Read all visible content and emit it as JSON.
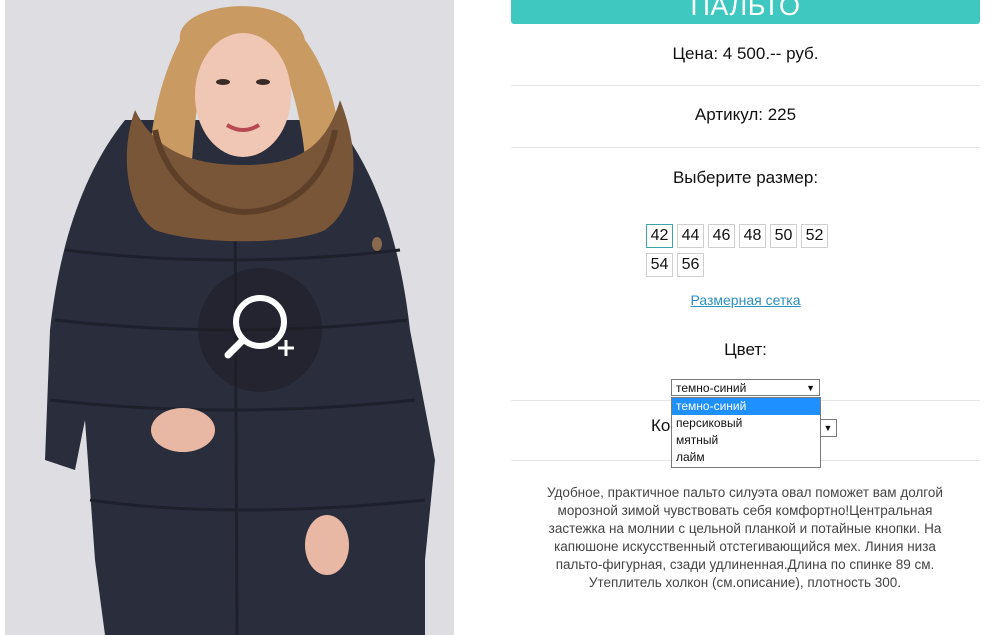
{
  "product": {
    "title": "ПАЛЬТО",
    "price_text": "Цена: 4 500.-- руб.",
    "sku_text": "Артикул: 225",
    "size_prompt": "Выберите размер:",
    "sizes": [
      "42",
      "44",
      "46",
      "48",
      "50",
      "52",
      "54",
      "56"
    ],
    "selected_size": "42",
    "size_chart_link": "Размерная сетка",
    "color_label": "Цвет:",
    "color_selected": "темно-синий",
    "color_options": [
      "темно-синий",
      "персиковый",
      "мятный",
      "лайм"
    ],
    "quantity_label_visible": "Ко",
    "description": "Удобное, практичное пальто силуэта овал поможет вам долгой морозной зимой чувствовать себя комфортно!Центральная застежка на молнии с цельной планкой и потайные кнопки. На капюшоне искусственный отстегивающийся мех. Линия низа пальто-фигурная, сзади удлиненная.Длина по спинке 89 см. Утеплитель холкон (см.описание), плотность 300."
  },
  "colors": {
    "accent": "#3ec8c0",
    "link": "#2b8ec0",
    "option_highlight": "#1e90ff"
  },
  "icons": {
    "zoom": "zoom-in-icon",
    "dropdown": "chevron-down-icon"
  }
}
